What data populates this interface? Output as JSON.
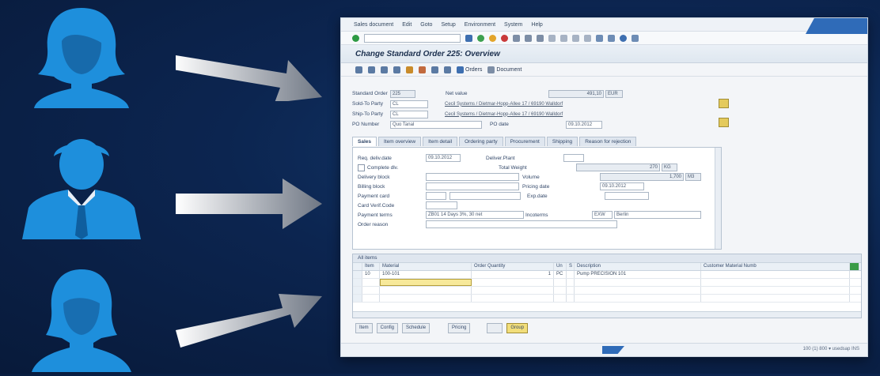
{
  "menu": [
    "Sales document",
    "Edit",
    "Goto",
    "Setup",
    "Environment",
    "System",
    "Help"
  ],
  "window_title": "Change Standard Order 225: Overview",
  "app_toolbar": {
    "orders": "Orders",
    "document": "Document"
  },
  "header": {
    "standard_order_label": "Standard Order",
    "standard_order_value": "225",
    "net_value_label": "Net value",
    "net_value_value": "491,10",
    "currency": "EUR",
    "sold_to_label": "Sold-To Party",
    "sold_to_value": "CL",
    "sold_to_desc": "Cecil Systems / Dietmar-Hopp-Allee 17 / 69190 Walldorf",
    "ship_to_label": "Ship-To Party",
    "ship_to_value": "CL",
    "ship_to_desc": "Cecil Systems / Dietmar-Hopp-Allee 17 / 69190 Walldorf",
    "po_number_label": "PO Number",
    "po_number_value": "Quo Tanal",
    "po_date_label": "PO date",
    "po_date_value": "09.10.2012"
  },
  "tabs": [
    "Sales",
    "Item overview",
    "Item detail",
    "Ordering party",
    "Procurement",
    "Shipping",
    "Reason for rejection"
  ],
  "sales_tab": {
    "req_deliv_date_label": "Req. deliv.date",
    "req_deliv_date_value": "09.10.2012",
    "deliver_plant_label": "Deliver.Plant",
    "complete_dlv_label": "Complete dlv.",
    "total_weight_label": "Total Weight",
    "total_weight_value": "270",
    "total_weight_unit": "KG",
    "delivery_block_label": "Delivery block",
    "volume_label": "Volume",
    "volume_value": "1,700",
    "volume_unit": "M3",
    "billing_block_label": "Billing block",
    "pricing_date_label": "Pricing date",
    "pricing_date_value": "09.10.2012",
    "payment_card_label": "Payment card",
    "exp_date_label": "Exp.date",
    "card_verif_code_label": "Card Verif.Code",
    "payment_terms_label": "Payment terms",
    "payment_terms_value": "ZB01 14 Days 3%, 30 net",
    "incoterms_label": "Incoterms",
    "incoterms_code": "EXW",
    "incoterms_value": "Berlin",
    "order_reason_label": "Order reason"
  },
  "items": {
    "caption": "All items",
    "columns": [
      "Item",
      "Material",
      "Order Quantity",
      "Un",
      "S",
      "Description",
      "Customer Material Numb"
    ],
    "rows": [
      [
        "10",
        "100-101",
        "",
        "1",
        "PC",
        "",
        "Pump PRECISION 101",
        ""
      ]
    ]
  },
  "bottom_buttons": [
    "Item",
    "Config",
    "Schedule",
    "Pricing",
    "",
    "Group"
  ],
  "status_info": "100 (1) 800 ▾  usedsap  INS"
}
